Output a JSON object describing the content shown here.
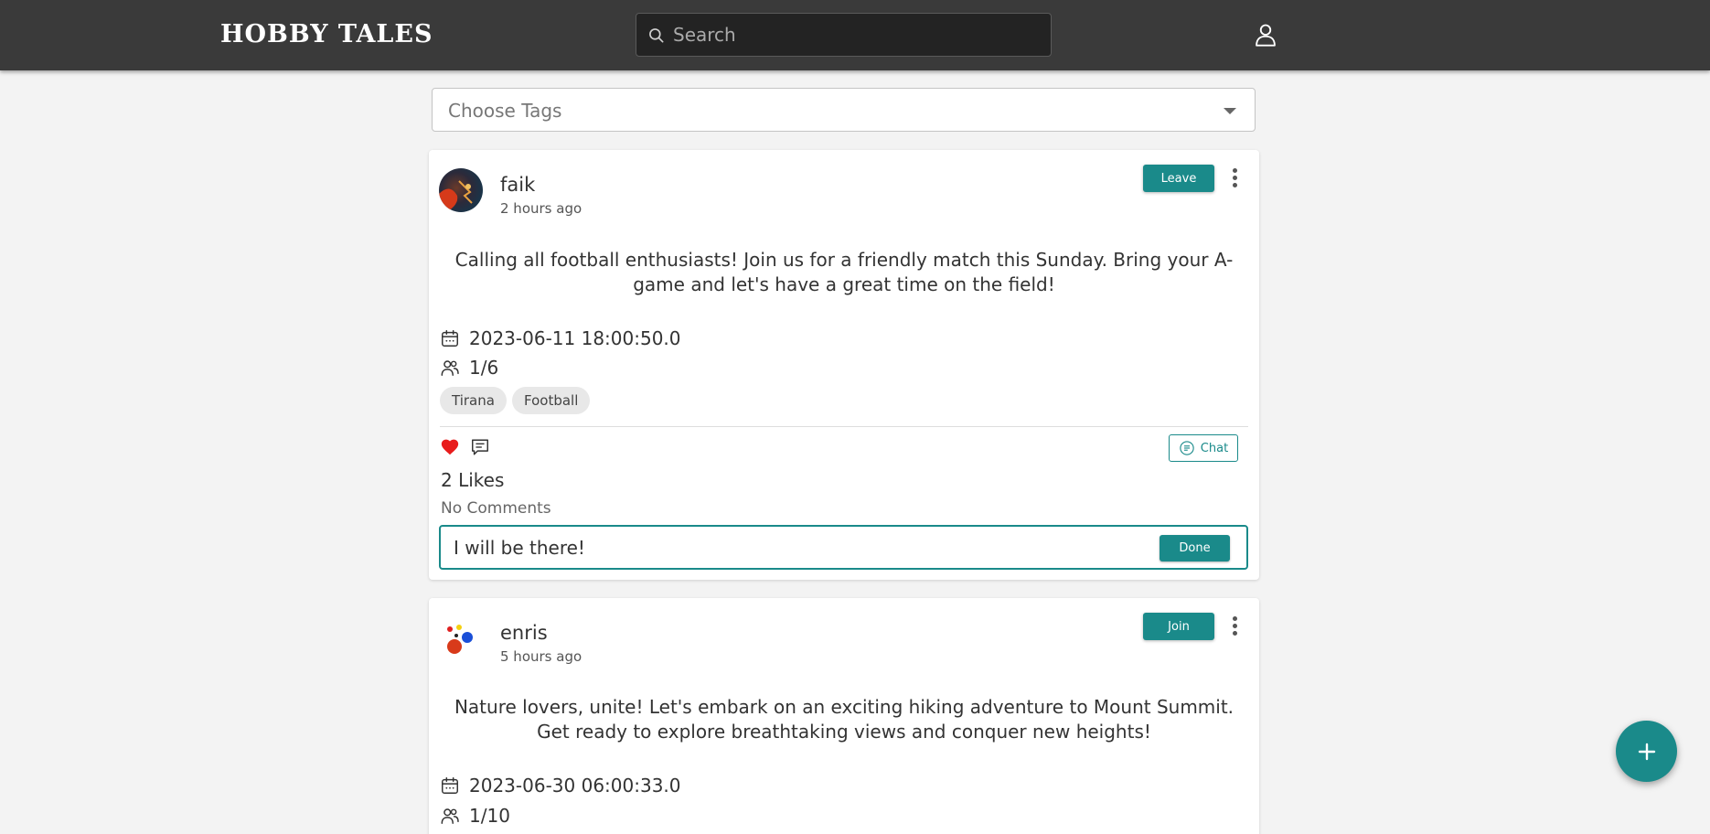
{
  "header": {
    "logo": "HOBBY TALES",
    "search_placeholder": "Search",
    "icons": {
      "search": "search-icon",
      "user": "user-icon"
    }
  },
  "filters": {
    "tags_placeholder": "Choose Tags"
  },
  "posts": [
    {
      "author": "faik",
      "time": "2 hours ago",
      "action_label": "Leave",
      "description": "Calling all football enthusiasts! Join us for a friendly match this Sunday. Bring your A-game and let's have a great time on the field!",
      "date": "2023-06-11 18:00:50.0",
      "participants": "1/6",
      "tags": [
        "Tirana",
        "Football"
      ],
      "liked": true,
      "likes_text": "2 Likes",
      "comments_text": "No Comments",
      "chat_label": "Chat",
      "comment_value": "I will be there!",
      "done_label": "Done"
    },
    {
      "author": "enris",
      "time": "5 hours ago",
      "action_label": "Join",
      "description": "Nature lovers, unite! Let's embark on an exciting hiking adventure to Mount Summit. Get ready to explore breathtaking views and conquer new heights!",
      "date": "2023-06-30 06:00:33.0",
      "participants": "1/10"
    }
  ],
  "colors": {
    "header_bg": "#3a3a3a",
    "accent": "#1a8a8a",
    "like": "#e81c1c",
    "page_bg": "#f3f3f3"
  },
  "fab": {
    "icon": "plus-icon"
  }
}
